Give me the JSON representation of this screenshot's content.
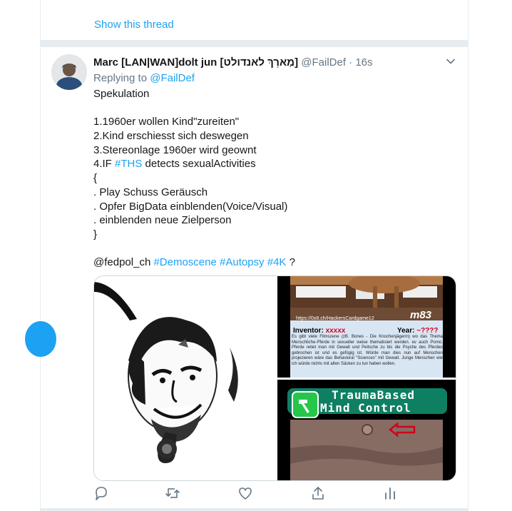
{
  "thread": {
    "show_thread_label": "Show this thread"
  },
  "tweet": {
    "display_name": "Marc [LAN|WAN]dolt jun [מַארְךְ לאנדולט]",
    "handle": "@FailDef",
    "dot": "·",
    "time": "16s",
    "replying_prefix": "Replying to",
    "replying_to": "@FailDef",
    "text_lines": [
      "Spekulation",
      "",
      "1.1960er wollen Kind\"zureiten\"",
      "2.Kind erschiesst sich deswegen",
      "3.Stereonlage 1960er wird geownt",
      "4.IF ",
      "{",
      ". Play Schuss Geräusch",
      ". Opfer BigData einblenden(Voice/Visual)",
      ". einblenden neue Zielperson",
      "}",
      "",
      "@fedpol_ch "
    ],
    "line4_hashtag": "#THS",
    "line4_rest": " detects sexualActivities",
    "hashtags_last": [
      "#Demoscene",
      "#Autopsy",
      "#4K"
    ],
    "last_suffix": " ?"
  },
  "media": {
    "card1": {
      "url": "https://0x8.ch/HackersCardgame12",
      "tag": "m83",
      "inventor_label": "Inventor:",
      "inventor_value": "xxxxx",
      "year_label": "Year:",
      "year_value": "~????",
      "body": "Es gibt viele Filmszene (zB. Bones - Die Knochenjägerin) wo das Thema Menschliche-Pferde in sexueller weise thematisiert werden. ev auch Porno. Pferde reitet man mit Gewalt und Peitsche zu bis die Psyche des Pferdes gebrochen ist und es gefügig ist. Würde man dies nun auf Menschen projezieren wäre das Behavioral \"Sciences\" mit Gewalt. Junge Menschen wie ich würde nichts mit alten Säcken zu tun haben wollen."
    },
    "card2": {
      "title_line1": "TraumaBased",
      "title_line2": "Mind Control"
    }
  },
  "icons": {
    "reply": "reply-icon",
    "retweet": "retweet-icon",
    "like": "heart-icon",
    "share": "share-icon",
    "analytics": "analytics-icon",
    "caret": "chevron-down-icon"
  },
  "colors": {
    "accent": "#1da1f2",
    "muted": "#657786",
    "text": "#14171a",
    "separator": "#e6ecf0"
  }
}
